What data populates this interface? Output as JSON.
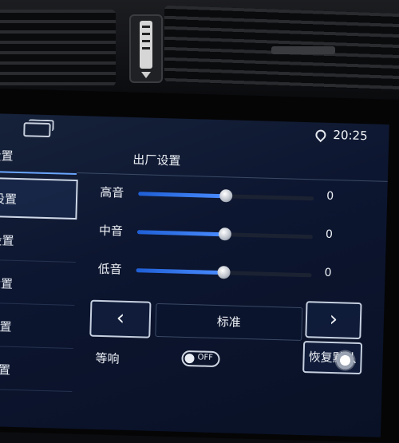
{
  "status": {
    "time": "20:25"
  },
  "tabs": {
    "left_label": "设置",
    "right_label": "出厂设置"
  },
  "sidebar": {
    "items": [
      {
        "label": "设置",
        "active": true
      },
      {
        "label": "设置"
      },
      {
        "label": "设置"
      },
      {
        "label": "设置"
      },
      {
        "label": "设置"
      }
    ]
  },
  "audio": {
    "rows": [
      {
        "label": "高音",
        "value": "0",
        "level": 0.5
      },
      {
        "label": "中音",
        "value": "0",
        "level": 0.5
      },
      {
        "label": "低音",
        "value": "0",
        "level": 0.5
      }
    ],
    "preset": {
      "label": "标准"
    },
    "loudness": {
      "label": "等响",
      "toggle_text": "OFF"
    },
    "restore_label": "恢复默认"
  },
  "icons": {
    "screen": "screen-icon",
    "location": "location-pin-icon",
    "left_arrow": "chevron-left-icon",
    "right_arrow": "chevron-right-icon",
    "assist": "assistive-touch-icon"
  },
  "colors": {
    "accent": "#4a8cff",
    "screen_bg": "#0d1630"
  }
}
